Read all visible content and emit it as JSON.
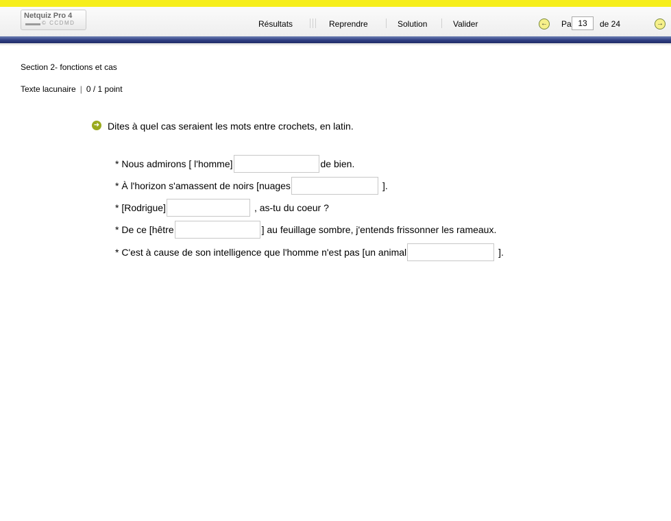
{
  "app": {
    "logo_name": "Netquiz Pro 4",
    "logo_org": "© CCDMD"
  },
  "toolbar": {
    "resultats": "Résultats",
    "reprendre": "Reprendre",
    "solution": "Solution",
    "valider": "Valider",
    "page_label": "Page",
    "page_current": "13",
    "page_total": "de 24",
    "prev_icon": "left-arrow-circle-icon",
    "next_icon": "right-arrow-circle-icon"
  },
  "header": {
    "section": "Section 2- fonctions et cas",
    "type": "Texte lacunaire",
    "separator": "|",
    "score": "0 / 1 point"
  },
  "question": {
    "icon": "arrow-right-circle-icon",
    "instruction": "Dites à quel cas seraient les mots entre crochets, en latin.",
    "lines": [
      {
        "before": "* Nous admirons [ l'homme]",
        "value": "",
        "after": "de bien."
      },
      {
        "before": "* À l'horizon s'amassent de noirs [nuages",
        "value": "",
        "after": "]."
      },
      {
        "before": "* [Rodrigue]",
        "value": "",
        "after": ", as-tu du coeur ?"
      },
      {
        "before": "* De ce [hêtre",
        "value": "",
        "after": "] au feuillage sombre, j'entends frissonner les rameaux."
      },
      {
        "before": "* C'est à cause de son intelligence que l'homme n'est pas [un animal",
        "value": "",
        "after": "]."
      }
    ]
  },
  "colors": {
    "top_stripe": "#f6ee1c",
    "blue_band": "#2f3f82",
    "accent_green": "#9aaa1e"
  }
}
